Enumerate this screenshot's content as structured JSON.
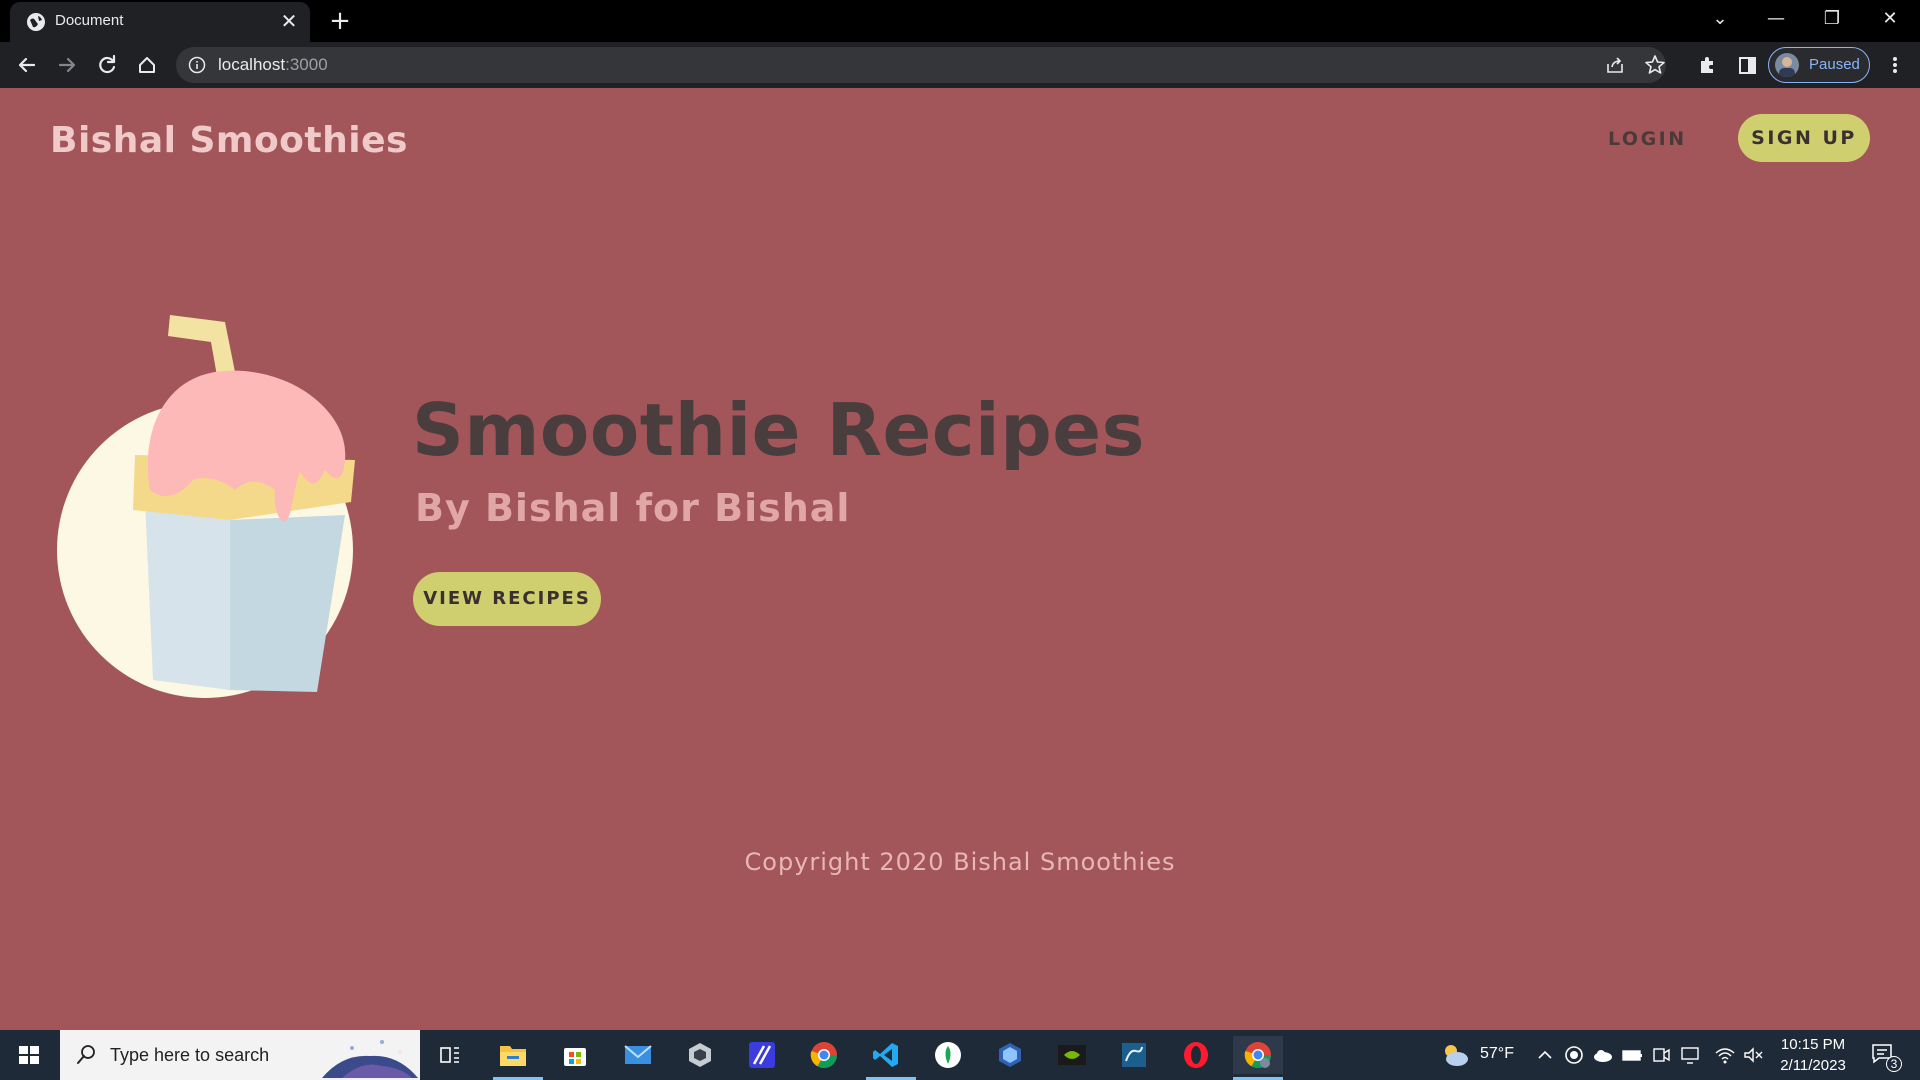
{
  "browser": {
    "tab_title": "Document",
    "tab_close": "✕",
    "new_tab": "+",
    "url_host": "localhost",
    "url_port": ":3000",
    "profile_status": "Paused",
    "window_controls": {
      "list": "⌄",
      "minimize": "—",
      "restore": "❐",
      "close": "✕"
    }
  },
  "page": {
    "brand": "Bishal Smoothies",
    "nav": {
      "login": "LOGIN",
      "signup": "SIGN UP"
    },
    "hero": {
      "title": "Smoothie Recipes",
      "subtitle": "By Bishal for Bishal",
      "button": "VIEW RECIPES"
    },
    "footer": "Copyright 2020 Bishal Smoothies",
    "colors": {
      "background": "#a3565a",
      "accent_button": "#cfcf70",
      "brand_text": "#f0c9c9",
      "title_text": "#4a3d3d",
      "subtitle_text": "#e1a7a7"
    }
  },
  "taskbar": {
    "search_placeholder": "Type here to search",
    "weather": "57°F",
    "time": "10:15 PM",
    "date": "2/11/2023",
    "notification_count": "3",
    "apps": [
      "task-view",
      "file-explorer",
      "microsoft-store",
      "mail",
      "unity",
      "affinity",
      "chrome",
      "vscode",
      "mongodb-compass",
      "virtualbox",
      "nvidia",
      "mysql-workbench",
      "opera",
      "chrome-active"
    ]
  }
}
